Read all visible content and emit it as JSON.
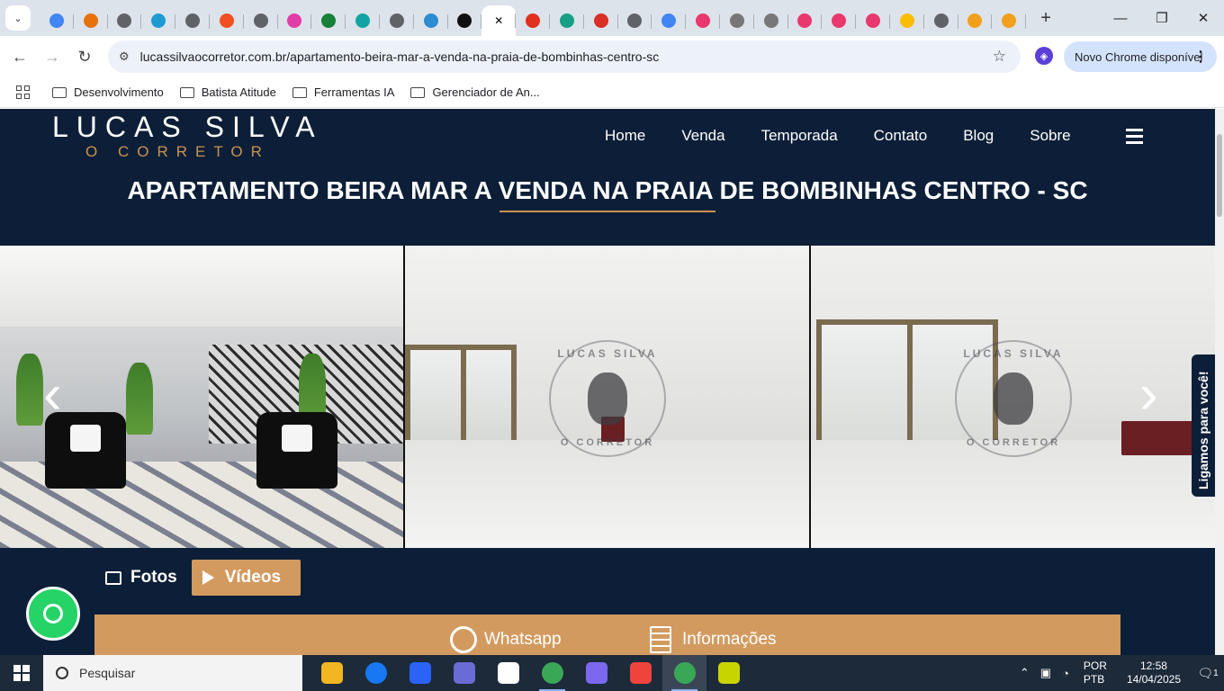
{
  "browser": {
    "tab_count_icons": [
      "chrome-icon",
      "puzzle-icon",
      "globe-icon",
      "edge-icon",
      "globe-icon",
      "flame-icon",
      "globe-icon",
      "m-icon",
      "sheets-icon",
      "hex-icon",
      "globe-icon",
      "cloud-icon",
      "openai-icon",
      "close-icon",
      "triangle-icon",
      "feather-icon",
      "fox-icon",
      "globe-icon",
      "google-icon",
      "k-icon",
      "circle-icon",
      "circle-icon",
      "k-icon",
      "k-icon",
      "k-icon",
      "pinwheel-icon",
      "globe-icon",
      "crown-icon",
      "crown-icon"
    ],
    "new_tab_label": "+",
    "url": "lucassilvaocorretor.com.br/apartamento-beira-mar-a-venda-na-praia-de-bombinhas-centro-sc",
    "update_label": "Novo Chrome disponível",
    "bookmarks": [
      "Desenvolvimento",
      "Batista Atitude",
      "Ferramentas IA",
      "Gerenciador de An..."
    ]
  },
  "site": {
    "logo_main": "LUCAS SILVA",
    "logo_sub": "O CORRETOR",
    "menu": [
      "Home",
      "Venda",
      "Temporada",
      "Contato",
      "Blog",
      "Sobre"
    ],
    "page_title": "APARTAMENTO BEIRA MAR A VENDA NA PRAIA DE BOMBINHAS CENTRO - SC",
    "watermark_top": "LUCAS SILVA",
    "watermark_bottom": "O CORRETOR",
    "prev_arrow": "‹",
    "next_arrow": "›",
    "call_tab": "Ligamos para você!",
    "tabs": {
      "photos": "Fotos",
      "videos": "Vídeos"
    },
    "contact": {
      "whatsapp": "Whatsapp",
      "info": "Informações"
    },
    "accent": "#d39a5f",
    "bg": "#0d1f38"
  },
  "taskbar": {
    "search_placeholder": "Pesquisar",
    "apps": [
      {
        "name": "file-explorer-icon",
        "color": "#f2b622"
      },
      {
        "name": "facebook-icon",
        "color": "#1877f2"
      },
      {
        "name": "dropbox-icon",
        "color": "#2a63f5"
      },
      {
        "name": "m365-icon",
        "color": "#6b6bd6"
      },
      {
        "name": "notion-icon",
        "color": "#ffffff"
      },
      {
        "name": "chrome-icon",
        "color": "#3aa757"
      },
      {
        "name": "clickup-icon",
        "color": "#7b68ee"
      },
      {
        "name": "anydesk-icon",
        "color": "#ef443b"
      },
      {
        "name": "chrome-profile-icon",
        "color": "#3aa757"
      },
      {
        "name": "fireworks-icon",
        "color": "#c8d400"
      }
    ],
    "lang_1": "POR",
    "lang_2": "PTB",
    "time": "12:58",
    "date": "14/04/2025",
    "notifications": "1"
  }
}
